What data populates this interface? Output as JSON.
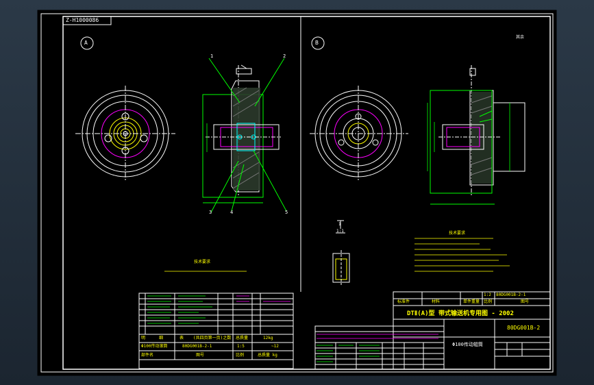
{
  "drawing_code": "Z-H1000086",
  "views": {
    "a_label": "A",
    "b_label": "B"
  },
  "callouts": [
    "1",
    "2",
    "3",
    "4",
    "5"
  ],
  "section_label": {
    "num": "1",
    "scale": "1:1"
  },
  "roughness_note": "其余",
  "tech_note_a": "技术要求",
  "tech_req_b_title": "技术要求",
  "title_block_right": {
    "product": "DTⅡ(A)型 带式输送机专用图 - 2002",
    "drawing_no": "80DG001B-2",
    "part_name": "Φ100传动辊筒",
    "code_cell": "80DG001B-2-1",
    "scale": "1:2",
    "row_labels": [
      "标准件",
      "材料",
      "单件重量",
      "比例",
      "图号"
    ]
  },
  "title_block_left": {
    "header": [
      "明",
      "细",
      "表",
      "(共四页第一页)之数",
      "总质量",
      "12kg"
    ],
    "name": "Φ100传动滚筒",
    "code": "80DG001B-2-1",
    "scale": "1:5",
    "weight": "~12",
    "footer": [
      "部件名",
      "图号",
      "比例",
      "总质量 kg"
    ]
  },
  "colors": {
    "frame": "#ffffff",
    "line": "#00ff00",
    "accent": "#ff00ff",
    "text": "#ffff00",
    "cyan": "#00ffff"
  }
}
